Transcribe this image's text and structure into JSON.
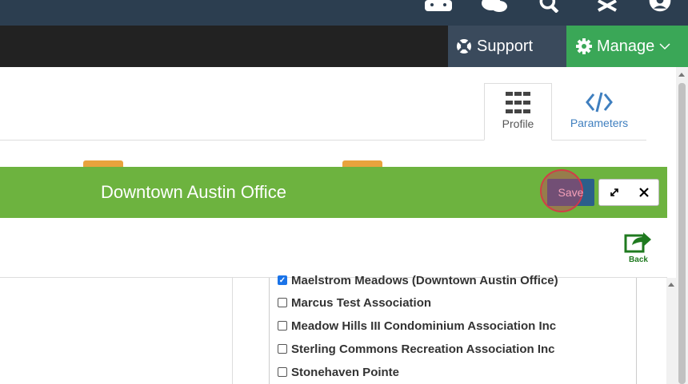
{
  "nav": {
    "support_label": "Support",
    "manage_label": "Manage"
  },
  "tabs": [
    {
      "label": "Profile",
      "icon": "list-icon"
    },
    {
      "label": "Parameters",
      "icon": "code-icon"
    }
  ],
  "modal": {
    "title": "Downtown Austin Office",
    "save_label": "Save",
    "back_label": "Back"
  },
  "associations": [
    {
      "label": "Maelstrom Meadows (Downtown Austin Office)",
      "checked": true
    },
    {
      "label": "Marcus Test Association",
      "checked": false
    },
    {
      "label": "Meadow Hills III Condominium Association Inc",
      "checked": false
    },
    {
      "label": "Sterling Commons Recreation Association Inc",
      "checked": false
    },
    {
      "label": "Stonehaven Pointe",
      "checked": false
    }
  ],
  "colors": {
    "topbar": "#2c3e50",
    "manage": "#3aa757",
    "modal_header": "#6db33f",
    "orange_tab": "#e8a33d",
    "save_button": "#2c5f8a"
  }
}
